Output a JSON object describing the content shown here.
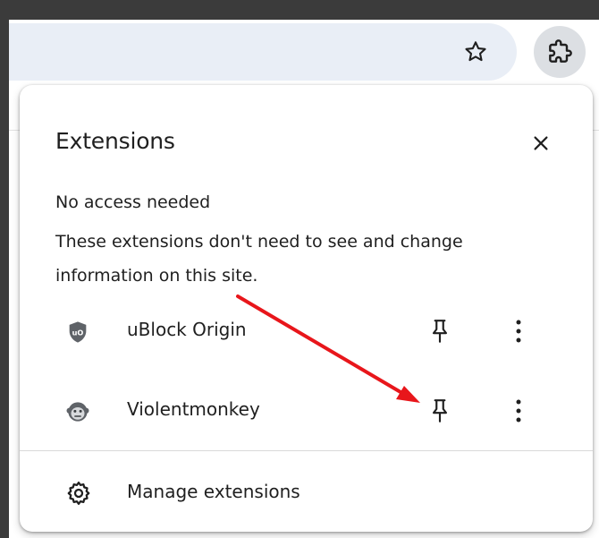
{
  "toolbar": {
    "star_icon": "star-outline-icon",
    "extensions_icon": "puzzle-piece-icon"
  },
  "popup": {
    "title": "Extensions",
    "close_icon": "close-icon",
    "section": {
      "heading": "No access needed",
      "description": "These extensions don't need to see and change information on this site."
    },
    "extensions": [
      {
        "name": "uBlock Origin",
        "icon": "ublock-shield-icon",
        "pin_icon": "pin-icon",
        "menu_icon": "more-vert-icon"
      },
      {
        "name": "Violentmonkey",
        "icon": "monkey-icon",
        "pin_icon": "pin-icon",
        "menu_icon": "more-vert-icon"
      }
    ],
    "manage": {
      "label": "Manage extensions",
      "icon": "gear-icon"
    }
  },
  "annotation": {
    "type": "arrow",
    "color": "#e8161b"
  },
  "colors": {
    "accent_icon": "#5f6368",
    "text": "#1f1f1f",
    "toolbar_bg": "#e9eef6"
  }
}
